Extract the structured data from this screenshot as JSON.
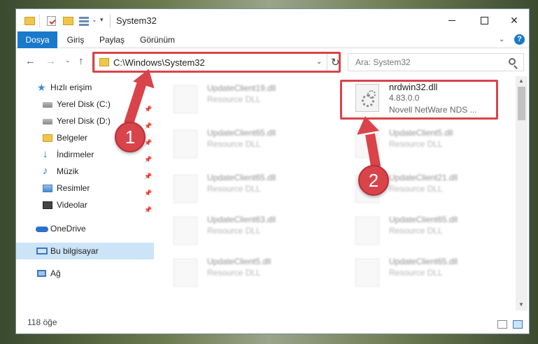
{
  "window": {
    "title": "System32",
    "close_glyph": "✕",
    "help_glyph": "?"
  },
  "ribbon": {
    "tabs": [
      "Dosya",
      "Giriş",
      "Paylaş",
      "Görünüm"
    ],
    "expand_glyph": "⌄"
  },
  "nav": {
    "address": "C:\\Windows\\System32",
    "search_placeholder": "Ara: System32",
    "back_glyph": "←",
    "forward_glyph": "→",
    "up_glyph": "↑",
    "dropdown_glyph": "⌄",
    "refresh_glyph": "↻"
  },
  "sidebar": {
    "items": [
      {
        "label": "Hızlı erişim",
        "icon": "star-icon"
      },
      {
        "label": "Yerel Disk (C:)",
        "icon": "drive-icon",
        "pinned": true
      },
      {
        "label": "Yerel Disk (D:)",
        "icon": "drive-icon",
        "pinned": true
      },
      {
        "label": "Belgeler",
        "icon": "folder-icon",
        "pinned": true
      },
      {
        "label": "İndirmeler",
        "icon": "download-icon",
        "pinned": true
      },
      {
        "label": "Müzik",
        "icon": "music-icon",
        "pinned": true
      },
      {
        "label": "Resimler",
        "icon": "pictures-icon",
        "pinned": true
      },
      {
        "label": "Videolar",
        "icon": "video-icon",
        "pinned": true
      },
      {
        "label": "OneDrive",
        "icon": "cloud-icon"
      },
      {
        "label": "Bu bilgisayar",
        "icon": "pc-icon",
        "selected": true
      },
      {
        "label": "Ağ",
        "icon": "network-icon"
      }
    ],
    "pin_glyph": "📌"
  },
  "files": {
    "focused": {
      "name": "nrdwin32.dll",
      "version": "4.83.0.0",
      "company": "Novell NetWare NDS ..."
    },
    "left_column": [
      {
        "name": "UpdateClient19.dll",
        "desc": "Resource DLL"
      },
      {
        "name": "UpdateClient65.dll",
        "desc": "Resource DLL"
      },
      {
        "name": "UpdateClient65.dll",
        "desc": "Resource DLL"
      },
      {
        "name": "UpdateClient63.dll",
        "desc": "Resource DLL"
      },
      {
        "name": "UpdateClient5.dll",
        "desc": "Resource DLL"
      }
    ],
    "right_column": [
      {
        "name": "UpdateClient5.dll",
        "desc": "Resource DLL"
      },
      {
        "name": "UpdateClient21.dll",
        "desc": "Resource DLL"
      },
      {
        "name": "UpdateClient65.dll",
        "desc": "Resource DLL"
      },
      {
        "name": "UpdateClient65.dll",
        "desc": "Resource DLL"
      }
    ]
  },
  "status": {
    "count": "118 öğe"
  },
  "annotations": {
    "step1": "1",
    "step2": "2"
  },
  "colors": {
    "accent": "#1979ca",
    "highlight": "#d9434a",
    "selected": "#cce4f7"
  }
}
